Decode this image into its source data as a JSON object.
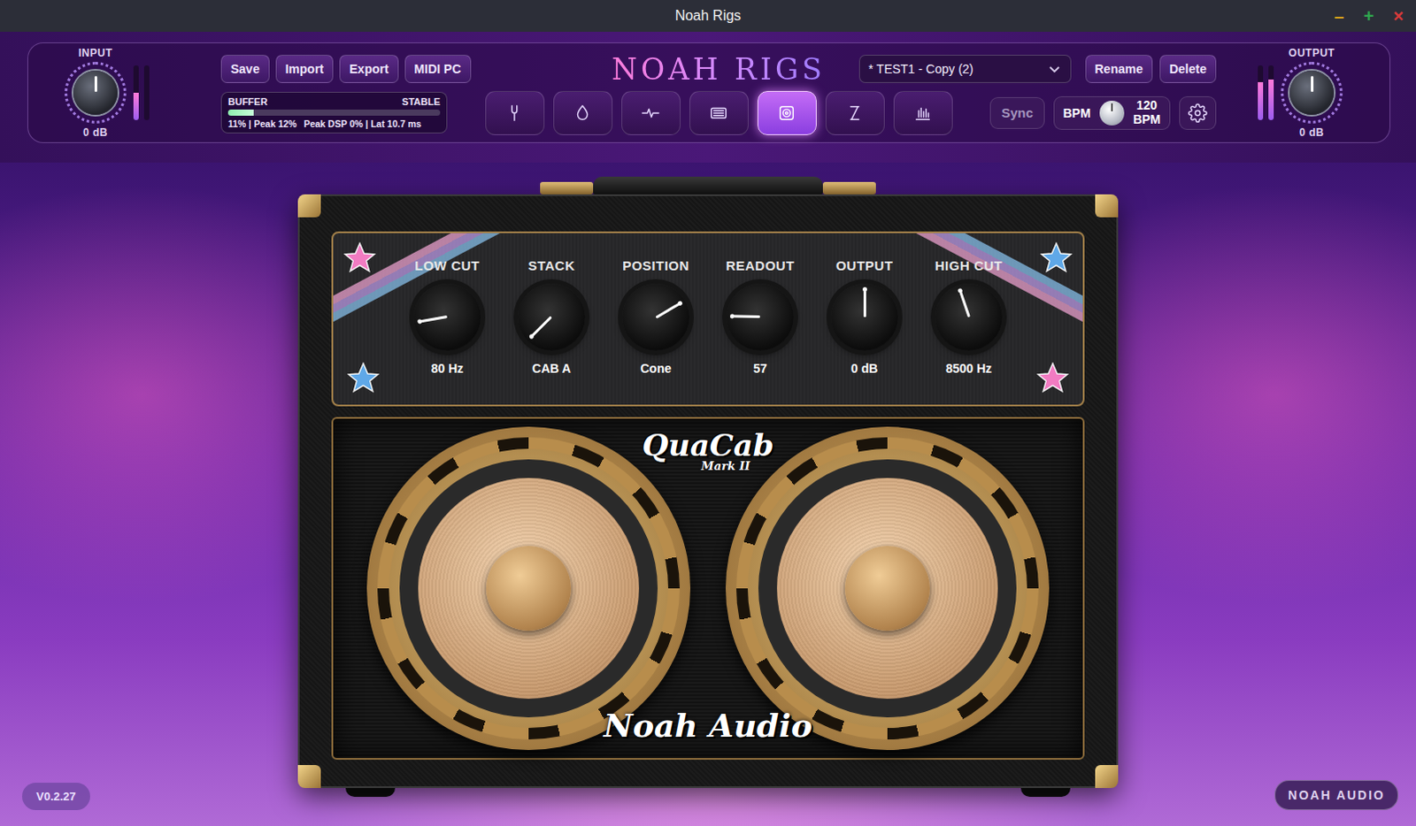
{
  "window": {
    "title": "Noah Rigs",
    "controls": [
      {
        "glyph": "–",
        "color": "#d9a21b"
      },
      {
        "glyph": "+",
        "color": "#2fa84f"
      },
      {
        "glyph": "×",
        "color": "#d93a3a"
      }
    ]
  },
  "input": {
    "label": "INPUT",
    "reading": "0 dB",
    "level": 0.5,
    "meters": [
      0.5,
      0.0
    ]
  },
  "output": {
    "label": "OUTPUT",
    "reading": "0 dB",
    "level": 0.5,
    "meters": [
      0.7,
      0.75
    ]
  },
  "file_buttons": [
    "Save",
    "Import",
    "Export",
    "MIDI PC"
  ],
  "buffer": {
    "label": "BUFFER",
    "status": "STABLE",
    "level": 0.12,
    "stats": "11% | Peak 12%",
    "dsp": "Peak DSP 0% | Lat 10.7 ms"
  },
  "logo": "NOAH RIGS",
  "modules": [
    {
      "kind": "tuner",
      "selected": false
    },
    {
      "kind": "drive",
      "selected": false
    },
    {
      "kind": "gate",
      "selected": false
    },
    {
      "kind": "amp",
      "selected": false
    },
    {
      "kind": "cab",
      "selected": true
    },
    {
      "kind": "delay",
      "selected": false
    },
    {
      "kind": "eq",
      "selected": false
    }
  ],
  "preset": {
    "name": "* TEST1 - Copy (2)"
  },
  "preset_buttons": [
    "Rename",
    "Delete"
  ],
  "sync": {
    "label": "Sync",
    "on": false
  },
  "bpm": {
    "label": "BPM",
    "value": "120",
    "unit": "BPM",
    "level": 0.5
  },
  "cab": {
    "knobs": [
      {
        "label": "LOW CUT",
        "value": "80 Hz",
        "level": 0.13
      },
      {
        "label": "STACK",
        "value": "CAB A",
        "level": 0.0
      },
      {
        "label": "POSITION",
        "value": "Cone",
        "level": 0.72
      },
      {
        "label": "READOUT",
        "value": "57",
        "level": 0.17
      },
      {
        "label": "OUTPUT",
        "value": "0 dB",
        "level": 0.5
      },
      {
        "label": "HIGH CUT",
        "value": "8500 Hz",
        "level": 0.43
      }
    ],
    "logo": "QuaCab",
    "model": "Mark II",
    "brand": "Noah Audio"
  },
  "version": "V0.2.27",
  "footer": "NOAH AUDIO"
}
